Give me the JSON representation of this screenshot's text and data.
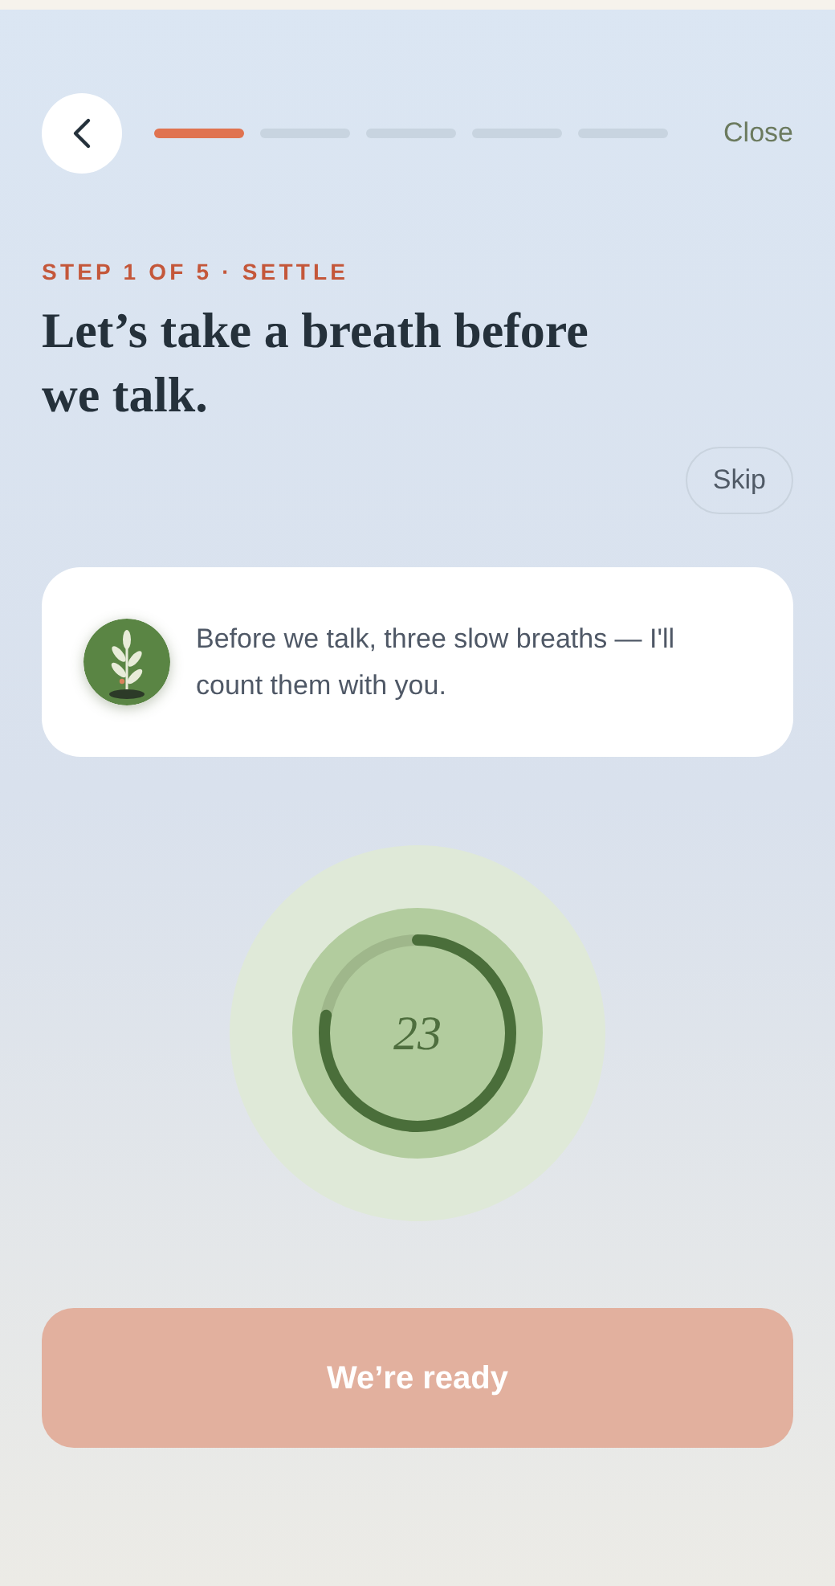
{
  "header": {
    "close": "Close"
  },
  "progress_steps": [
    {
      "selected": true
    },
    {
      "selected": false
    },
    {
      "selected": false
    },
    {
      "selected": false
    },
    {
      "selected": false
    }
  ],
  "step_label": "STEP 1 OF 5 · SETTLE",
  "title": "Let’s take a breath before we talk.",
  "skip": "Skip",
  "message": {
    "text": "Before we talk, three slow breaths — I'll count them with you."
  },
  "timer": {
    "count": "23",
    "level": 0.78
  },
  "primary_button": {
    "label": "We’re ready",
    "disabled": true
  }
}
